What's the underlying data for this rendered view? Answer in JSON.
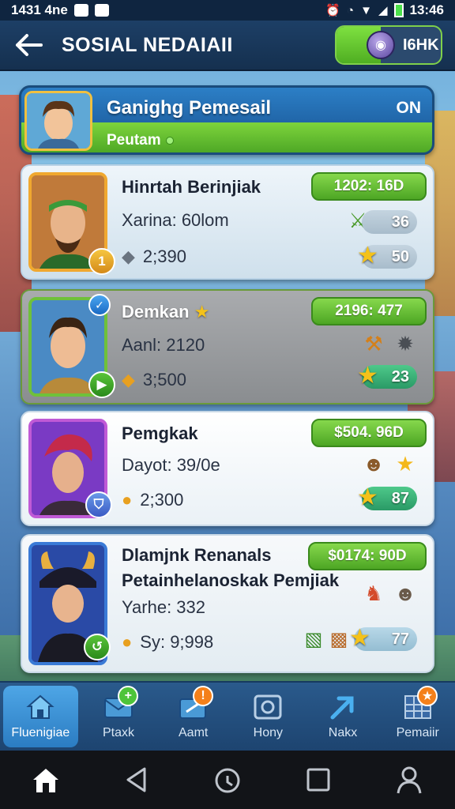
{
  "status_bar": {
    "time_left": "1431 4ne",
    "time_right": "13:46"
  },
  "header": {
    "title": "SOSIAL NEDAIAII",
    "toggle_label": "I6HK"
  },
  "player": {
    "name": "Ganighg Pemesail",
    "state": "ON",
    "status": "Peutam"
  },
  "cards": [
    {
      "name": "Hinrtah Berinjiak",
      "detail": "Xarina: 60lom",
      "currency": "2;390",
      "price": "1202: 16D",
      "stat1": "36",
      "stat2": "50",
      "level_badge": "1"
    },
    {
      "name": "Demkan",
      "detail": "Aanl: 2120",
      "currency": "3;500",
      "price": "2196: 477",
      "stat2": "23"
    },
    {
      "name": "Pemgkak",
      "detail": "Dayot: 39/0e",
      "currency": "2;300",
      "price": "$504. 96D",
      "stat2": "87"
    },
    {
      "name": "Dlamjnk Renanals",
      "name2": "Petainhelanoskak Pemjiak",
      "detail": "Yarhe: 332",
      "currency": "Sy: 9;998",
      "price": "$0174: 90D",
      "stat2": "77"
    }
  ],
  "bottom_nav": {
    "items": [
      {
        "label": "Fluenigiae",
        "icon": "home-icon"
      },
      {
        "label": "Ptaxk",
        "icon": "mail-icon",
        "badge": "+"
      },
      {
        "label": "Aamt",
        "icon": "send-icon",
        "badge": "!"
      },
      {
        "label": "Hony",
        "icon": "camera-icon"
      },
      {
        "label": "Nakx",
        "icon": "arrow-icon"
      },
      {
        "label": "Pemaiir",
        "icon": "grid-icon",
        "badge": "★"
      }
    ]
  },
  "colors": {
    "accent_green": "#5ab82a",
    "header_blue": "#15304f",
    "nav_blue": "#2a5a8c"
  }
}
